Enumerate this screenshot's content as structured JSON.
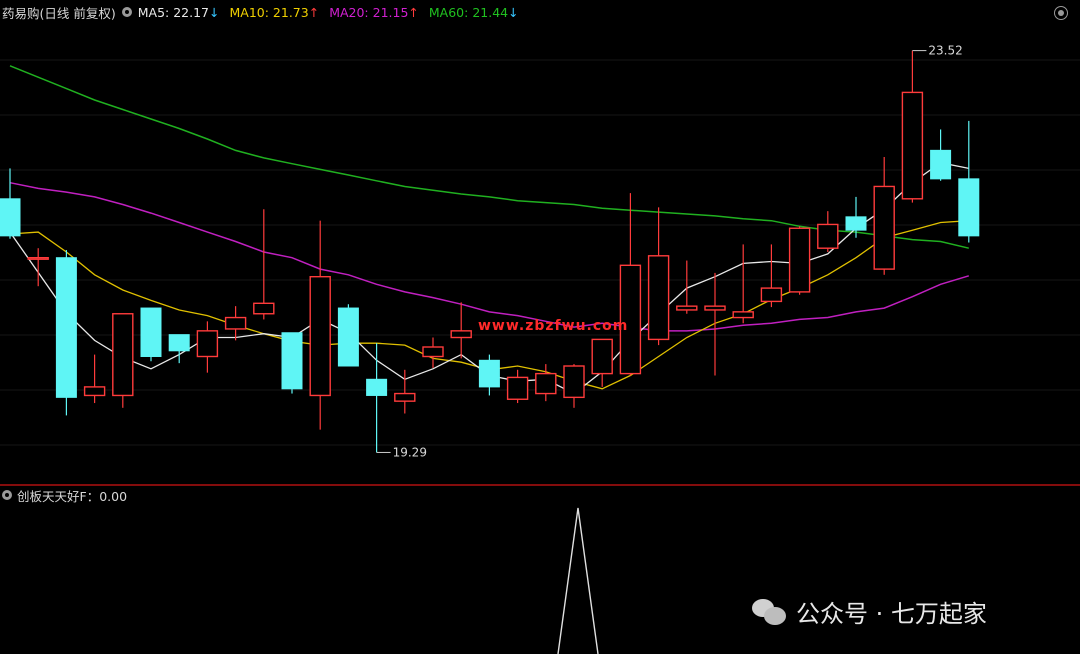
{
  "header": {
    "title": "药易购(日线 前复权)",
    "ma5": {
      "label": "MA5: 22.17",
      "arrow": "↓",
      "color": "#e8e8e8"
    },
    "ma10": {
      "label": "MA10: 21.73",
      "arrow": "↑",
      "color": "#f0d000"
    },
    "ma20": {
      "label": "MA20: 21.15",
      "arrow": "↑",
      "color": "#d020d0"
    },
    "ma60": {
      "label": "MA60: 21.44",
      "arrow": "↓",
      "color": "#20c020"
    }
  },
  "indicator_header": {
    "label": "创板天天好F：0.00"
  },
  "watermarks": {
    "site": "www.zbzfwu.com",
    "account": "公众号 · 七万起家"
  },
  "colors": {
    "up": "#ff3b3b",
    "down": "#5ff5f5",
    "ma5": "#e8e8e8",
    "ma10": "#e0c000",
    "ma20": "#c020c0",
    "ma60": "#20b020",
    "separator": "#b01010",
    "spike": "#e0e0e0"
  },
  "chart_data": {
    "type": "candlestick",
    "ylim": [
      19.0,
      23.8
    ],
    "annotations": [
      {
        "text": "23.52",
        "candle_index": 32,
        "value": 23.52
      },
      {
        "text": "19.29",
        "candle_index": 13,
        "value": 19.29
      }
    ],
    "candles": [
      {
        "o": 21.96,
        "c": 21.57,
        "h": 22.28,
        "l": 21.54
      },
      {
        "o": 21.34,
        "c": 21.34,
        "h": 21.44,
        "l": 21.04
      },
      {
        "o": 21.34,
        "c": 19.87,
        "h": 21.42,
        "l": 19.68
      },
      {
        "o": 19.89,
        "c": 19.98,
        "h": 20.32,
        "l": 19.81
      },
      {
        "o": 19.89,
        "c": 20.75,
        "h": 20.75,
        "l": 19.76
      },
      {
        "o": 20.81,
        "c": 20.3,
        "h": 20.81,
        "l": 20.25
      },
      {
        "o": 20.53,
        "c": 20.36,
        "h": 20.53,
        "l": 20.23
      },
      {
        "o": 20.3,
        "c": 20.57,
        "h": 20.67,
        "l": 20.13
      },
      {
        "o": 20.59,
        "c": 20.71,
        "h": 20.83,
        "l": 20.47
      },
      {
        "o": 20.75,
        "c": 20.86,
        "h": 21.85,
        "l": 20.69
      },
      {
        "o": 20.55,
        "c": 19.96,
        "h": 20.55,
        "l": 19.91
      },
      {
        "o": 19.89,
        "c": 21.14,
        "h": 21.73,
        "l": 19.53
      },
      {
        "o": 20.81,
        "c": 20.2,
        "h": 20.85,
        "l": 20.2
      },
      {
        "o": 20.06,
        "c": 19.89,
        "h": 20.44,
        "l": 19.29
      },
      {
        "o": 19.83,
        "c": 19.91,
        "h": 20.16,
        "l": 19.7
      },
      {
        "o": 20.3,
        "c": 20.4,
        "h": 20.5,
        "l": 20.18
      },
      {
        "o": 20.5,
        "c": 20.57,
        "h": 20.87,
        "l": 20.28
      },
      {
        "o": 20.26,
        "c": 19.98,
        "h": 20.32,
        "l": 19.89
      },
      {
        "o": 19.85,
        "c": 20.08,
        "h": 20.16,
        "l": 19.81
      },
      {
        "o": 19.91,
        "c": 20.12,
        "h": 20.22,
        "l": 19.83
      },
      {
        "o": 19.87,
        "c": 20.2,
        "h": 20.22,
        "l": 19.76
      },
      {
        "o": 20.12,
        "c": 20.48,
        "h": 20.48,
        "l": 19.98
      },
      {
        "o": 20.12,
        "c": 21.26,
        "h": 22.02,
        "l": 20.1
      },
      {
        "o": 20.48,
        "c": 21.36,
        "h": 21.87,
        "l": 20.42
      },
      {
        "o": 20.79,
        "c": 20.83,
        "h": 21.31,
        "l": 20.75
      },
      {
        "o": 20.79,
        "c": 20.83,
        "h": 21.18,
        "l": 20.1
      },
      {
        "o": 20.71,
        "c": 20.77,
        "h": 21.48,
        "l": 20.65
      },
      {
        "o": 20.88,
        "c": 21.02,
        "h": 21.48,
        "l": 20.82
      },
      {
        "o": 20.98,
        "c": 21.65,
        "h": 21.67,
        "l": 20.95
      },
      {
        "o": 21.44,
        "c": 21.69,
        "h": 21.83,
        "l": 21.4
      },
      {
        "o": 21.77,
        "c": 21.63,
        "h": 21.98,
        "l": 21.55
      },
      {
        "o": 21.22,
        "c": 22.09,
        "h": 22.4,
        "l": 21.16
      },
      {
        "o": 21.96,
        "c": 23.08,
        "h": 23.52,
        "l": 21.92
      },
      {
        "o": 22.47,
        "c": 22.17,
        "h": 22.69,
        "l": 22.15
      },
      {
        "o": 22.17,
        "c": 21.57,
        "h": 22.78,
        "l": 21.5
      }
    ],
    "ma5": [
      21.61,
      null,
      20.76,
      20.47,
      20.29,
      20.17,
      20.32,
      20.5,
      20.5,
      20.54,
      20.5,
      20.69,
      20.55,
      20.26,
      20.06,
      20.17,
      20.32,
      20.1,
      20.04,
      20.06,
      19.91,
      20.14,
      20.47,
      20.75,
      21.02,
      21.14,
      21.28,
      21.3,
      21.28,
      21.38,
      21.65,
      21.85,
      22.13,
      22.34,
      22.28
    ],
    "ma10": [
      21.59,
      21.61,
      21.4,
      21.16,
      21.0,
      20.89,
      20.79,
      20.73,
      20.63,
      20.54,
      20.46,
      20.42,
      20.44,
      20.44,
      20.42,
      20.28,
      20.24,
      20.16,
      20.2,
      20.14,
      20.04,
      19.96,
      20.1,
      20.3,
      20.5,
      20.65,
      20.75,
      20.9,
      21.02,
      21.16,
      21.34,
      21.55,
      21.63,
      21.71,
      21.73
    ],
    "ma20": [
      22.13,
      22.07,
      22.03,
      21.98,
      21.9,
      21.81,
      21.71,
      21.61,
      21.51,
      21.4,
      21.34,
      21.22,
      21.16,
      21.06,
      20.98,
      20.92,
      20.85,
      20.77,
      20.73,
      20.67,
      20.61,
      20.65,
      20.61,
      20.57,
      20.57,
      20.59,
      20.63,
      20.65,
      20.69,
      20.71,
      20.77,
      20.81,
      20.93,
      21.06,
      21.15
    ],
    "ma60": [
      23.36,
      23.24,
      23.12,
      23.0,
      22.9,
      22.8,
      22.7,
      22.59,
      22.47,
      22.39,
      22.33,
      22.27,
      22.21,
      22.15,
      22.09,
      22.05,
      22.01,
      21.98,
      21.94,
      21.92,
      21.9,
      21.86,
      21.84,
      21.82,
      21.8,
      21.78,
      21.75,
      21.73,
      21.67,
      21.63,
      21.61,
      21.57,
      21.53,
      21.51,
      21.44
    ],
    "indicator": {
      "name": "创板天天好F",
      "value_label": "0.00",
      "spike_index": 20,
      "spike_value": 1.0
    }
  }
}
